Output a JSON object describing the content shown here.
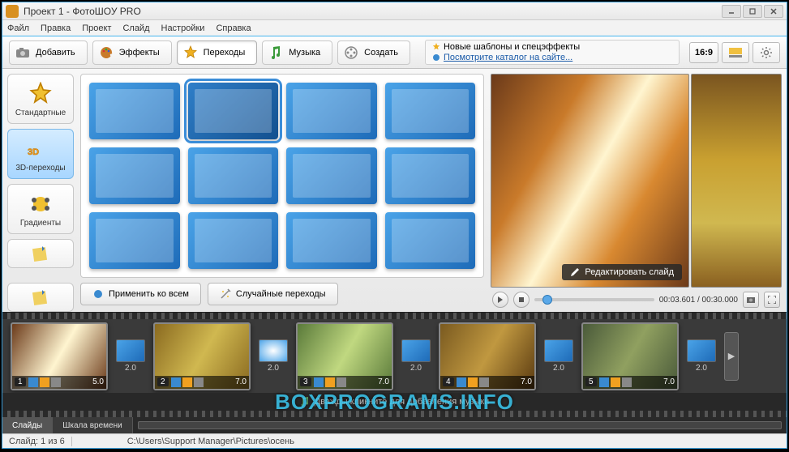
{
  "window": {
    "title": "Проект 1 - ФотоШОУ PRO"
  },
  "menu": {
    "file": "Файл",
    "edit": "Правка",
    "project": "Проект",
    "slide": "Слайд",
    "settings": "Настройки",
    "help": "Справка"
  },
  "tabs": {
    "add": "Добавить",
    "effects": "Эффекты",
    "transitions": "Переходы",
    "music": "Музыка",
    "create": "Создать"
  },
  "info": {
    "line1": "Новые шаблоны и спецэффекты",
    "line2": "Посмотрите каталог на сайте..."
  },
  "aspect": "16:9",
  "categories": {
    "standard": "Стандартные",
    "threeD": "3D-переходы",
    "gradients": "Градиенты"
  },
  "actions": {
    "applyAll": "Применить ко всем",
    "random": "Случайные переходы"
  },
  "preview": {
    "edit": "Редактировать слайд",
    "time": "00:03.601 / 00:30.000"
  },
  "timeline": {
    "slides": [
      {
        "n": "1",
        "d": "5.0"
      },
      {
        "n": "2",
        "d": "7.0"
      },
      {
        "n": "3",
        "d": "7.0"
      },
      {
        "n": "4",
        "d": "7.0"
      },
      {
        "n": "5",
        "d": "7.0"
      }
    ],
    "trans": [
      "2.0",
      "2.0",
      "2.0",
      "2.0",
      "2.0"
    ],
    "music": "Дважды кликните для добавления музыки",
    "tab1": "Слайды",
    "tab2": "Шкала времени"
  },
  "status": {
    "count": "Слайд: 1 из 6",
    "path": "C:\\Users\\Support Manager\\Pictures\\осень"
  },
  "watermark": "BOXPROGRAMS.INFO"
}
